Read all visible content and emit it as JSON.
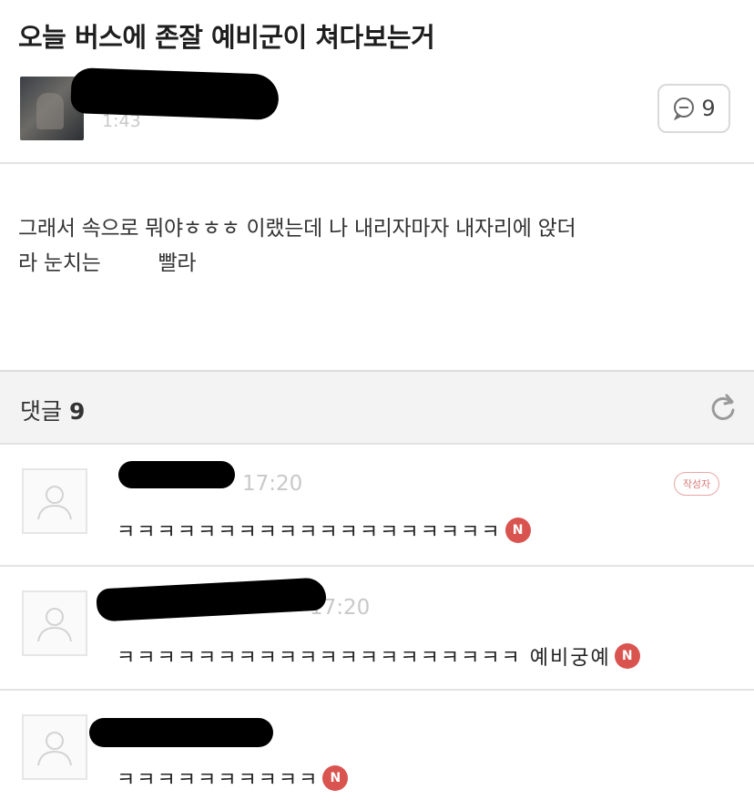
{
  "post": {
    "title": "오늘 버스에 존잘 예비군이 쳐다보는거",
    "meta_visible": "1:43",
    "comment_count": "9",
    "body_lines": [
      "그래서 속으로 뭐야ㅎㅎㅎ 이랬는데 나 내리자마자 내자리에 앉더",
      "라 눈치는         빨라"
    ]
  },
  "comments_section": {
    "label": "댓글",
    "count": "9"
  },
  "comments": [
    {
      "time": "17:20",
      "text": "ㅋㅋㅋㅋㅋㅋㅋㅋㅋㅋㅋㅋㅋㅋㅋㅋㅋㅋㅋ",
      "badge": "N",
      "writer_badge": "작성자"
    },
    {
      "time": "17:20",
      "text": "ㅋㅋㅋㅋㅋㅋㅋㅋㅋㅋㅋㅋㅋㅋㅋㅋㅋㅋㅋㅋ 예비궁예",
      "badge": "N"
    },
    {
      "time": "",
      "text": "ㅋㅋㅋㅋㅋㅋㅋㅋㅋㅋ",
      "badge": "N"
    }
  ],
  "colors": {
    "badge": "#d9534f",
    "section_bg": "#f3f3f4",
    "divider": "#e3e3e3"
  },
  "icons": [
    "comment-bubble-icon",
    "refresh-icon",
    "user-placeholder-icon",
    "new-badge-icon"
  ]
}
